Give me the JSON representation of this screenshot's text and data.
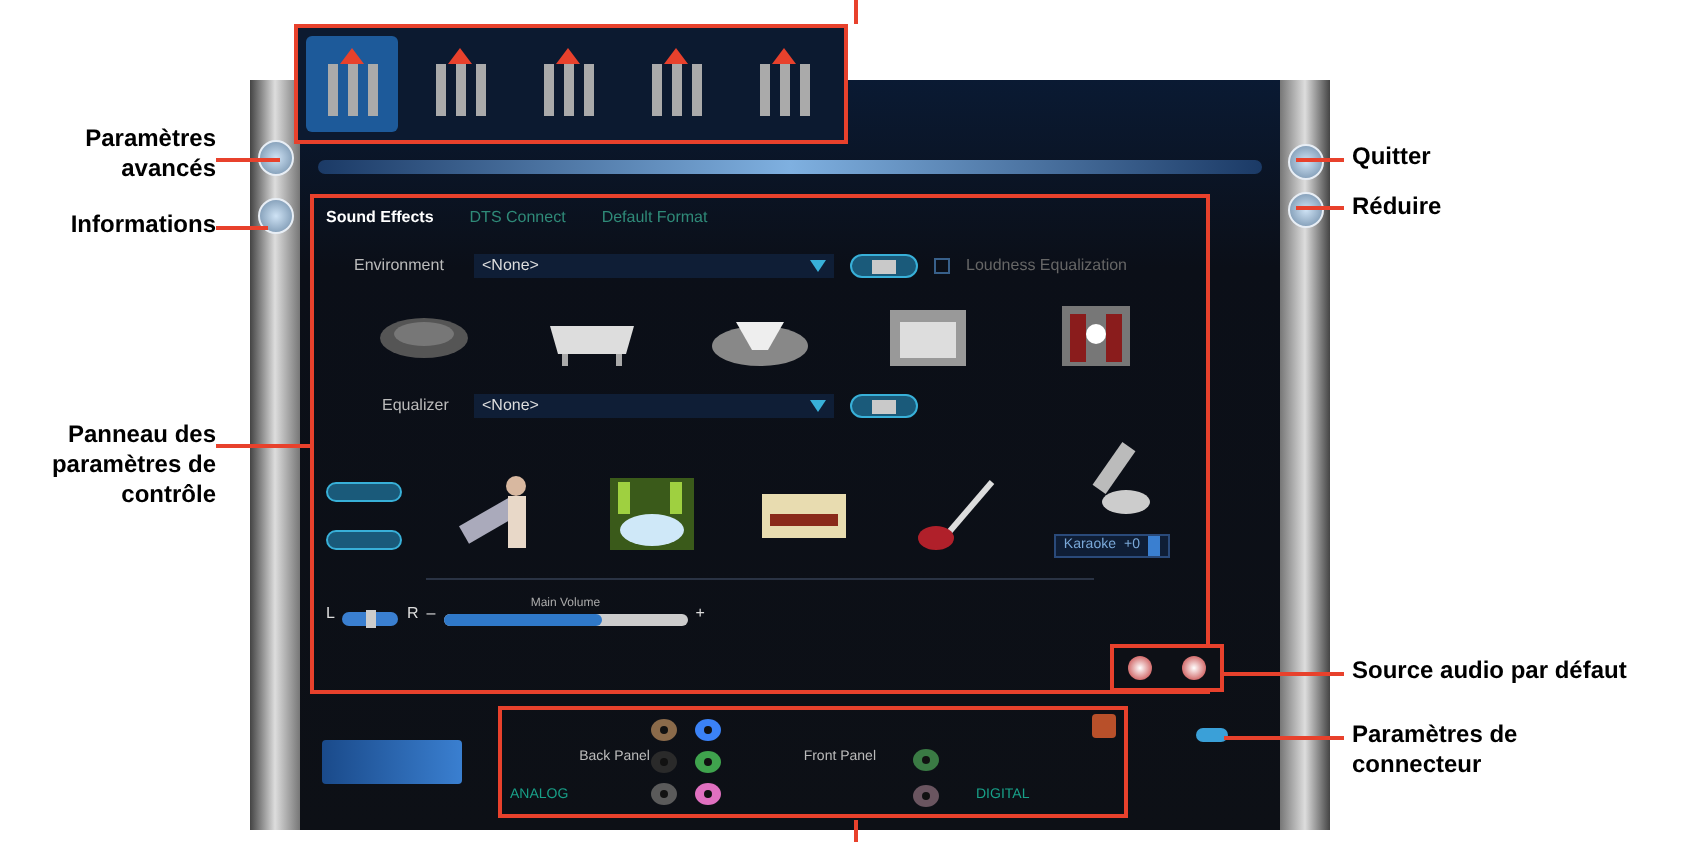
{
  "device_tabs": [
    {
      "selected": true
    },
    {
      "selected": false
    },
    {
      "selected": false
    },
    {
      "selected": false
    },
    {
      "selected": false
    }
  ],
  "panel": {
    "tabs": [
      {
        "label": "Sound Effects",
        "selected": true
      },
      {
        "label": "DTS Connect",
        "selected": false
      },
      {
        "label": "Default Format",
        "selected": false
      }
    ],
    "environment": {
      "label": "Environment",
      "value": "<None>"
    },
    "loudness": {
      "label": "Loudness Equalization",
      "checked": false
    },
    "equalizer": {
      "label": "Equalizer",
      "value": "<None>"
    },
    "karaoke": {
      "label": "Karaoke",
      "value": "+0"
    },
    "balance": {
      "level": 0.5
    },
    "volume": {
      "label": "Main Volume",
      "left": "L",
      "right": "R",
      "minus": "–",
      "plus": "+",
      "level": 0.65
    }
  },
  "connectors": {
    "back_label": "Back Panel",
    "front_label": "Front Panel",
    "analog": "ANALOG",
    "digital": "DIGITAL",
    "back_jacks": [
      {
        "color": "#8a6a4a"
      },
      {
        "color": "#3b82f6"
      },
      {
        "color": "#2a2a2a"
      },
      {
        "color": "#3fa34d"
      },
      {
        "color": "#5a5a5a"
      },
      {
        "color": "#e070c0"
      }
    ],
    "front_jacks": [
      {
        "color": "#3a7a44"
      },
      {
        "color": "#6a5560"
      }
    ]
  },
  "callouts": [
    {
      "text": "Paramètres avancés"
    },
    {
      "text": "Informations"
    },
    {
      "text": "Panneau des paramètres de contrôle"
    },
    {
      "text": "Quitter"
    },
    {
      "text": "Réduire"
    },
    {
      "text": "Source audio par défaut"
    },
    {
      "text": "Paramètres de connecteur"
    }
  ]
}
